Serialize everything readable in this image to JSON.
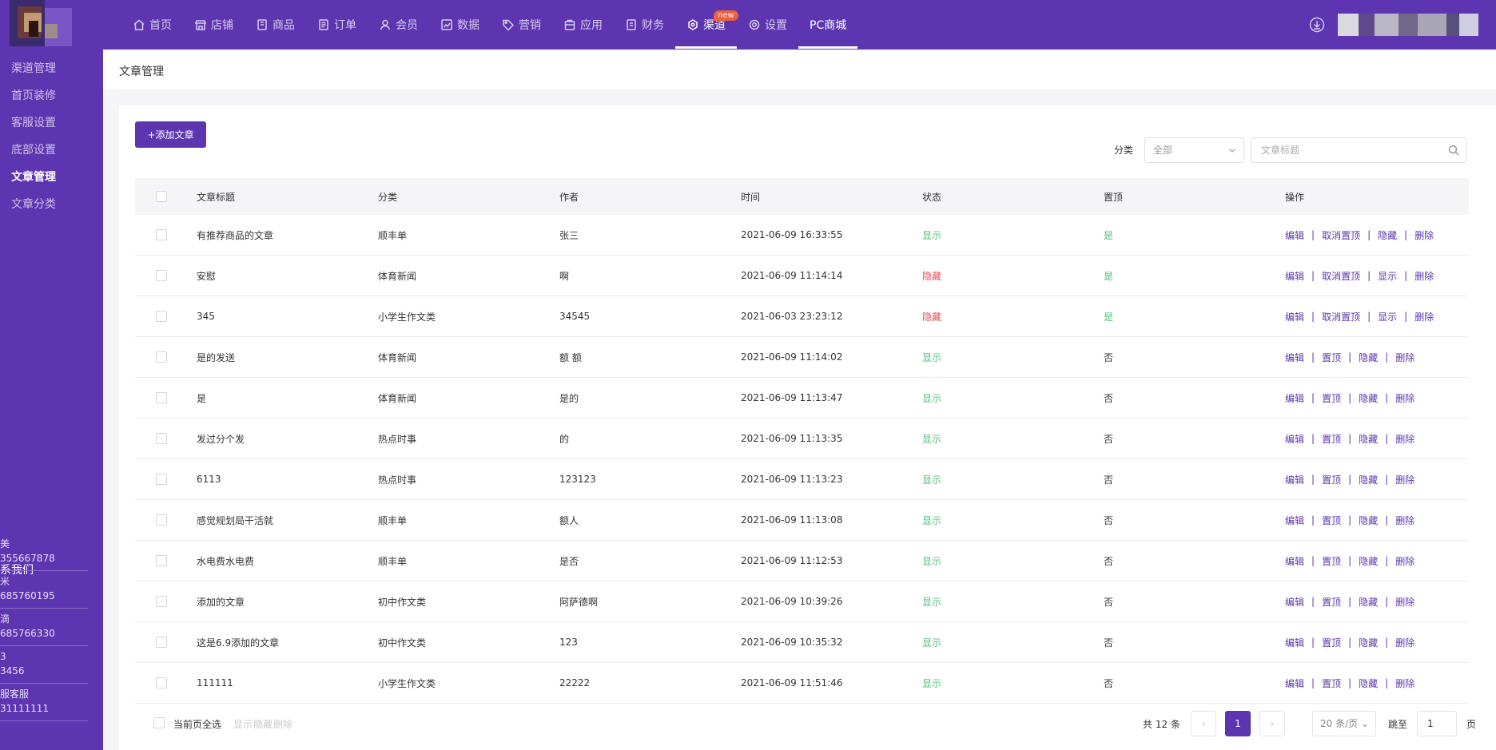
{
  "colors": {
    "brand": "#5d35b0",
    "show": "#52c07a",
    "hidden": "#e2525c"
  },
  "nav": {
    "items": [
      {
        "label": "首页",
        "icon": "home-icon"
      },
      {
        "label": "店铺",
        "icon": "store-icon"
      },
      {
        "label": "商品",
        "icon": "goods-icon"
      },
      {
        "label": "订单",
        "icon": "order-icon"
      },
      {
        "label": "会员",
        "icon": "member-icon"
      },
      {
        "label": "数据",
        "icon": "chart-icon"
      },
      {
        "label": "营销",
        "icon": "tag-icon"
      },
      {
        "label": "应用",
        "icon": "app-icon"
      },
      {
        "label": "财务",
        "icon": "finance-icon"
      },
      {
        "label": "渠道",
        "icon": "channel-icon"
      },
      {
        "label": "设置",
        "icon": "gear-icon"
      },
      {
        "label": "PC商城",
        "icon": ""
      }
    ],
    "badge": "new"
  },
  "sidebar": {
    "items": [
      "渠道管理",
      "首页装修",
      "客服设置",
      "底部设置",
      "文章管理",
      "文章分类"
    ],
    "contact_title": "系我们",
    "contacts": [
      {
        "name": "美",
        "phone": "355667878"
      },
      {
        "name": "米",
        "phone": "685760195"
      },
      {
        "name": "滴",
        "phone": "685766330"
      },
      {
        "name": "3",
        "phone": "3456"
      },
      {
        "name": "服客服",
        "phone": "31111111"
      }
    ]
  },
  "page": {
    "title": "文章管理"
  },
  "toolbar": {
    "add_label": "+添加文章",
    "category_label": "分类",
    "category_value": "全部",
    "search_placeholder": "文章标题"
  },
  "table": {
    "headers": [
      "文章标题",
      "分类",
      "作者",
      "时间",
      "状态",
      "置顶",
      "操作"
    ],
    "rows": [
      {
        "title": "有推荐商品的文章",
        "category": "顺丰单",
        "author": "张三",
        "time": "2021-06-09 16:33:55",
        "status": "显示",
        "pinned": "是",
        "ops": [
          "编辑",
          "取消置顶",
          "隐藏",
          "删除"
        ]
      },
      {
        "title": "安慰",
        "category": "体育新闻",
        "author": "啊",
        "time": "2021-06-09 11:14:14",
        "status": "隐藏",
        "pinned": "是",
        "ops": [
          "编辑",
          "取消置顶",
          "显示",
          "删除"
        ]
      },
      {
        "title": "345",
        "category": "小学生作文类",
        "author": "34545",
        "time": "2021-06-03 23:23:12",
        "status": "隐藏",
        "pinned": "是",
        "ops": [
          "编辑",
          "取消置顶",
          "显示",
          "删除"
        ]
      },
      {
        "title": "是的发送",
        "category": "体育新闻",
        "author": "额 额",
        "time": "2021-06-09 11:14:02",
        "status": "显示",
        "pinned": "否",
        "ops": [
          "编辑",
          "置顶",
          "隐藏",
          "删除"
        ]
      },
      {
        "title": "是",
        "category": "体育新闻",
        "author": "是的",
        "time": "2021-06-09 11:13:47",
        "status": "显示",
        "pinned": "否",
        "ops": [
          "编辑",
          "置顶",
          "隐藏",
          "删除"
        ]
      },
      {
        "title": "发过分个发",
        "category": "热点时事",
        "author": "的",
        "time": "2021-06-09 11:13:35",
        "status": "显示",
        "pinned": "否",
        "ops": [
          "编辑",
          "置顶",
          "隐藏",
          "删除"
        ]
      },
      {
        "title": "6113",
        "category": "热点时事",
        "author": "123123",
        "time": "2021-06-09 11:13:23",
        "status": "显示",
        "pinned": "否",
        "ops": [
          "编辑",
          "置顶",
          "隐藏",
          "删除"
        ]
      },
      {
        "title": "感觉规划局干活就",
        "category": "顺丰单",
        "author": "额人",
        "time": "2021-06-09 11:13:08",
        "status": "显示",
        "pinned": "否",
        "ops": [
          "编辑",
          "置顶",
          "隐藏",
          "删除"
        ]
      },
      {
        "title": "水电费水电费",
        "category": "顺丰单",
        "author": "是否",
        "time": "2021-06-09 11:12:53",
        "status": "显示",
        "pinned": "否",
        "ops": [
          "编辑",
          "置顶",
          "隐藏",
          "删除"
        ]
      },
      {
        "title": "添加的文章",
        "category": "初中作文类",
        "author": "阿萨德啊",
        "time": "2021-06-09 10:39:26",
        "status": "显示",
        "pinned": "否",
        "ops": [
          "编辑",
          "置顶",
          "隐藏",
          "删除"
        ]
      },
      {
        "title": "这是6.9添加的文章",
        "category": "初中作文类",
        "author": "123",
        "time": "2021-06-09 10:35:32",
        "status": "显示",
        "pinned": "否",
        "ops": [
          "编辑",
          "置顶",
          "隐藏",
          "删除"
        ]
      },
      {
        "title": "111111",
        "category": "小学生作文类",
        "author": "22222",
        "time": "2021-06-09 11:51:46",
        "status": "显示",
        "pinned": "否",
        "ops": [
          "编辑",
          "置顶",
          "隐藏",
          "删除"
        ]
      }
    ]
  },
  "footer": {
    "select_all": "当前页全选",
    "bulk": [
      "显示",
      "隐藏",
      "删除"
    ],
    "total": "共 12 条",
    "current_page": "1",
    "prev": "‹",
    "next": "›",
    "page_size": "20 条/页",
    "jump_label": "跳至",
    "jump_value": "1",
    "page_suffix": "页"
  }
}
